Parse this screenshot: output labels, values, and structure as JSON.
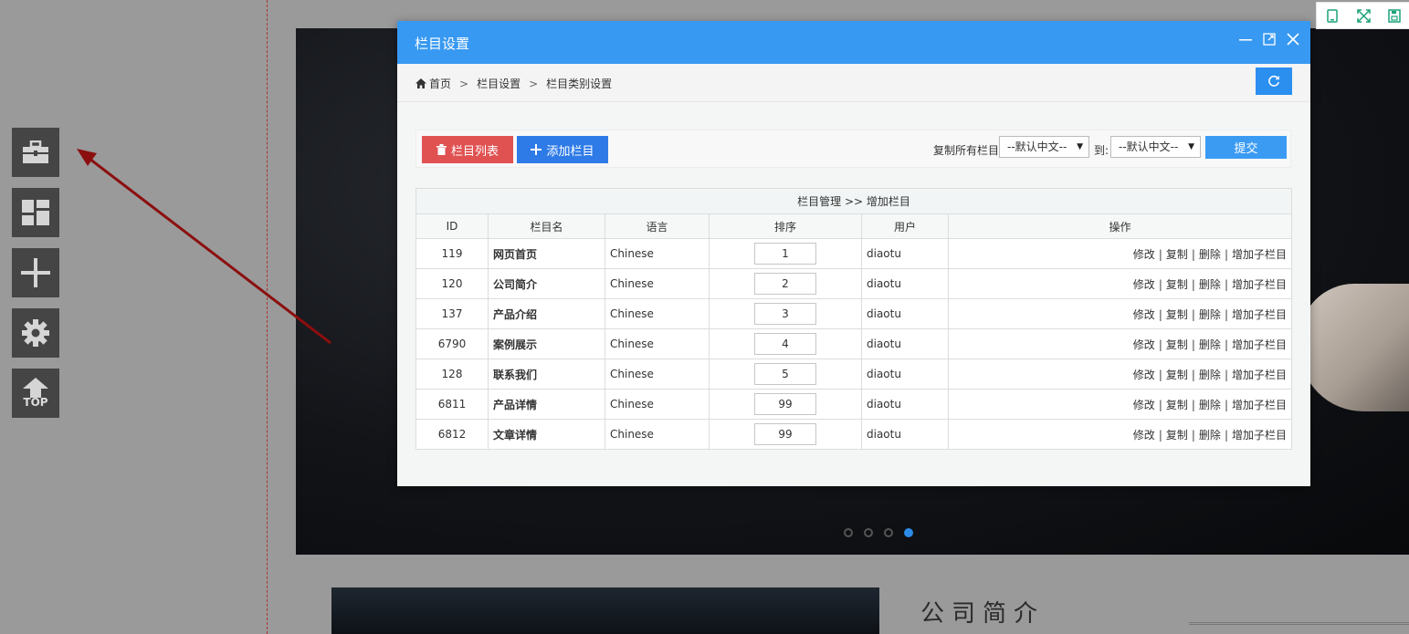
{
  "modal": {
    "title": "栏目设置",
    "breadcrumb": [
      "首页",
      "栏目设置",
      "栏目类别设置"
    ],
    "breadcrumb_sep": ">",
    "buttons": {
      "list": "栏目列表",
      "add": "添加栏目",
      "copy_label": "复制所有栏目",
      "from_select": "--默认中文--",
      "to_label": "到:",
      "to_select": "--默认中文--",
      "submit": "提交"
    },
    "table": {
      "caption": "栏目管理 >> 增加栏目",
      "headers": [
        "ID",
        "栏目名",
        "语言",
        "排序",
        "用户",
        "操作"
      ],
      "ops": {
        "edit": "修改",
        "copy": "复制",
        "delete": "删除",
        "add_child": "增加子栏目",
        "sep": "|"
      },
      "rows": [
        {
          "id": "119",
          "name": "网页首页",
          "lang": "Chinese",
          "sort": "1",
          "user": "diaotu"
        },
        {
          "id": "120",
          "name": "公司简介",
          "lang": "Chinese",
          "sort": "2",
          "user": "diaotu"
        },
        {
          "id": "137",
          "name": "产品介绍",
          "lang": "Chinese",
          "sort": "3",
          "user": "diaotu"
        },
        {
          "id": "6790",
          "name": "案例展示",
          "lang": "Chinese",
          "sort": "4",
          "user": "diaotu"
        },
        {
          "id": "128",
          "name": "联系我们",
          "lang": "Chinese",
          "sort": "5",
          "user": "diaotu"
        },
        {
          "id": "6811",
          "name": "产品详情",
          "lang": "Chinese",
          "sort": "99",
          "user": "diaotu"
        },
        {
          "id": "6812",
          "name": "文章详情",
          "lang": "Chinese",
          "sort": "99",
          "user": "diaotu"
        }
      ]
    }
  },
  "toolbar": {
    "top_label": "TOP",
    "icons": [
      "briefcase-icon",
      "grid-icon",
      "plus-icon",
      "gear-icon",
      "top-arrow-icon"
    ]
  },
  "page": {
    "section_heading": "公司简介",
    "slider_dots": 4,
    "active_dot": 3
  },
  "colors": {
    "header_blue": "#3799f2",
    "btn_red": "#e05251",
    "btn_blue": "#2e7be8",
    "mini_tool_green": "#1aa27a"
  }
}
